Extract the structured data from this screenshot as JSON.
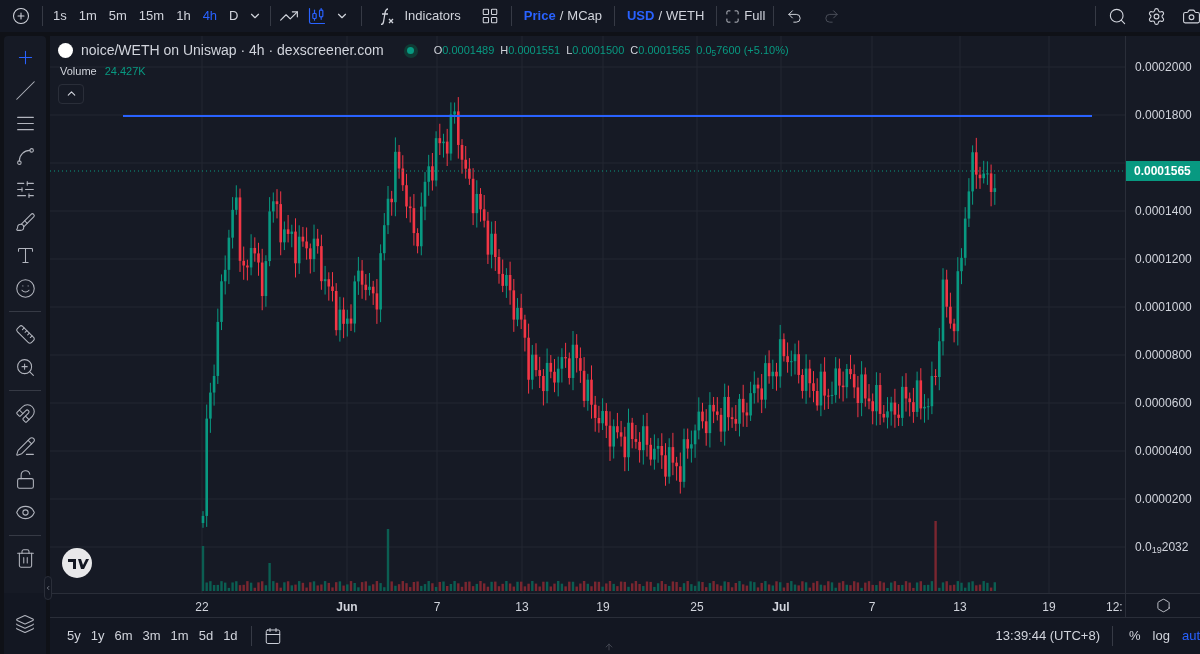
{
  "toolbar": {
    "intervals": [
      {
        "label": "1s",
        "selected": false
      },
      {
        "label": "1m",
        "selected": false
      },
      {
        "label": "5m",
        "selected": false
      },
      {
        "label": "15m",
        "selected": false
      },
      {
        "label": "1h",
        "selected": false
      },
      {
        "label": "4h",
        "selected": true
      },
      {
        "label": "D",
        "selected": false
      }
    ],
    "chart_types": [
      {
        "kind": "line",
        "selected": false
      },
      {
        "kind": "candles",
        "selected": true
      }
    ],
    "indicators": "Indicators",
    "price_toggle": {
      "options": [
        {
          "label": "Price",
          "selected": true
        },
        {
          "label": "MCap",
          "selected": false
        }
      ],
      "separator": "/"
    },
    "currency_toggle": {
      "options": [
        {
          "label": "USD",
          "selected": true
        },
        {
          "label": "WETH",
          "selected": false
        }
      ],
      "separator": "/"
    },
    "fullscreen": "Full",
    "undo": {
      "disabled": false
    },
    "redo": {
      "disabled": true
    }
  },
  "left_tools": [
    {
      "kind": "crosshair",
      "selected": true
    },
    {
      "kind": "trend-line",
      "selected": false
    },
    {
      "kind": "lines",
      "selected": false
    },
    {
      "kind": "pattern",
      "selected": false
    },
    {
      "kind": "fib",
      "selected": false
    },
    {
      "kind": "brush",
      "selected": false
    },
    {
      "kind": "text",
      "selected": false
    },
    {
      "kind": "emoji",
      "selected": false
    },
    {
      "kind": "ruler",
      "selected": false
    },
    {
      "kind": "zoom",
      "selected": false
    },
    {
      "kind": "magnet",
      "selected": false
    },
    {
      "kind": "draw-lock",
      "selected": false
    },
    {
      "kind": "lock",
      "selected": false
    },
    {
      "kind": "eye",
      "selected": false
    },
    {
      "kind": "trash",
      "selected": false
    }
  ],
  "legend": {
    "title": "noice/WETH on Uniswap · 4h · dexscreener.com",
    "live": true,
    "ohlc": [
      {
        "key": "O",
        "value": "0.0001489"
      },
      {
        "key": "H",
        "value": "0.0001551"
      },
      {
        "key": "L",
        "value": "0.0001500"
      },
      {
        "key": "C",
        "value": "0.0001565"
      }
    ],
    "change": "0.0$_{5}$7600 (+5.10%)",
    "volume_label": "Volume",
    "volume_value": "24.427K"
  },
  "price_axis": {
    "ticks": [
      "0.0002000",
      "0.0001800",
      "0.0001400",
      "0.0001200",
      "0.0001000",
      "0.0000800",
      "0.0000600",
      "0.0000400",
      "0.0000200",
      "0.0$_{19}$2032"
    ],
    "last_price": "0.0001565"
  },
  "time_axis": {
    "ticks": [
      {
        "label": "22",
        "bold": false
      },
      {
        "label": "Jun",
        "bold": true
      },
      {
        "label": "7",
        "bold": false
      },
      {
        "label": "13",
        "bold": false
      },
      {
        "label": "19",
        "bold": false
      },
      {
        "label": "25",
        "bold": false
      },
      {
        "label": "Jul",
        "bold": true
      },
      {
        "label": "7",
        "bold": false
      },
      {
        "label": "13",
        "bold": false
      },
      {
        "label": "19",
        "bold": false
      },
      {
        "label": "12:",
        "bold": false
      }
    ]
  },
  "bottom_bar": {
    "ranges": [
      "5y",
      "1y",
      "6m",
      "3m",
      "1m",
      "5d",
      "1d"
    ],
    "clock": "13:39:44 (UTC+8)",
    "percent": "%",
    "log": "log",
    "auto": {
      "label": "aut",
      "on": true
    }
  }
}
